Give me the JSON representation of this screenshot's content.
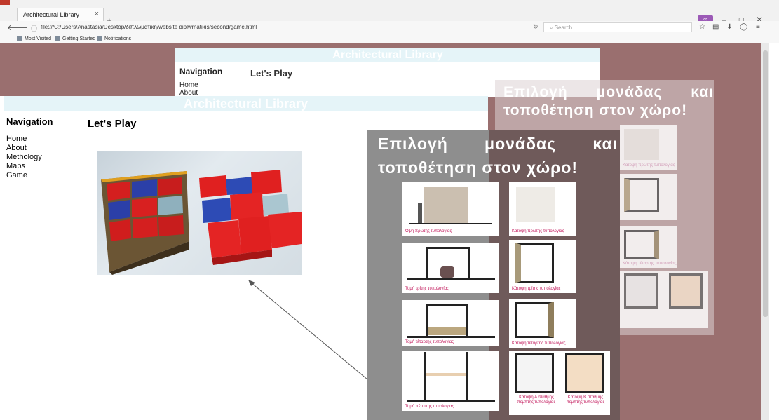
{
  "browser": {
    "tab_title": "Architectural Library",
    "tab_close": "×",
    "new_tab": "+",
    "url": "file:///C:/Users/Anastasia/Desktop/διπλωματικη/website diplwmatikis/second/game.html",
    "search_placeholder": "Search",
    "bookmarks": [
      "Most Visited",
      "Getting Started",
      "Notifications"
    ],
    "window_controls": [
      "–",
      "▢",
      "✕"
    ],
    "badge": "∞"
  },
  "site_back": {
    "title": "Architectural Library",
    "nav_heading": "Navigation",
    "nav_items": [
      "Home",
      "About"
    ],
    "page_heading": "Let's Play"
  },
  "site_front": {
    "title": "Architectural Library",
    "nav_heading": "Navigation",
    "nav_items": [
      "Home",
      "About",
      "Methology",
      "Maps",
      "Game"
    ],
    "page_heading": "Let's Play"
  },
  "overlay": {
    "title_line1": "Επιλογή μονάδας και",
    "title_line2": "τοποθέτηση στον χώρο!",
    "cards_left": [
      "Όψη πρώτης τυπολογίας",
      "Τομή τρίτης τυπολογίας",
      "Τομή τέταρτης τυπολογίας",
      "Τομή πέμπτης τυπολογίας"
    ],
    "cards_right": [
      "Κάτοψη πρώτης τυπολογίας",
      "Κάτοψη τρίτης τυπολογίας",
      "Κάτοψη τέταρτης τυπολογίας"
    ],
    "cards_pair": [
      "Κάτοψη Α στάθμης πέμπτης τυπολογίας",
      "Κάτοψη Β στάθμης πέμπτης τυπολογίας"
    ]
  }
}
